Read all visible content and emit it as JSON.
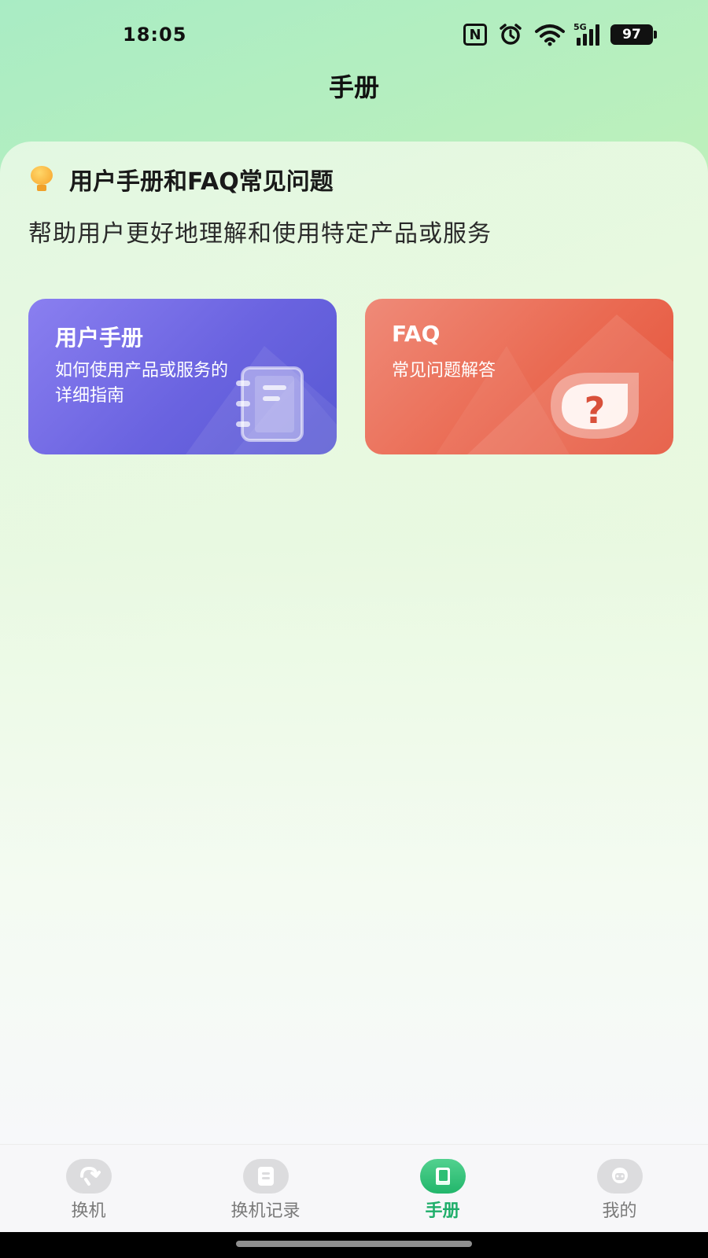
{
  "status_bar": {
    "time": "18:05",
    "nfc_label": "N",
    "network": "5G",
    "battery": "97",
    "icons": [
      "nfc-icon",
      "alarm-icon",
      "wifi-icon",
      "signal-icon",
      "battery-icon"
    ]
  },
  "header": {
    "title": "手册"
  },
  "section": {
    "title": "用户手册和FAQ常见问题",
    "description": "帮助用户更好地理解和使用特定产品或服务",
    "icon": "lightbulb-icon"
  },
  "cards": [
    {
      "title": "用户手册",
      "subtitle": "如何使用产品或服务的详细指南",
      "icon": "notebook-icon",
      "color": "#6a63e0"
    },
    {
      "title": "FAQ",
      "subtitle": "常见问题解答",
      "icon": "question-bubble-icon",
      "color": "#ea6a52"
    }
  ],
  "tab_bar": {
    "tabs": [
      {
        "label": "换机",
        "icon": "phone-swap-icon",
        "active": false
      },
      {
        "label": "换机记录",
        "icon": "document-icon",
        "active": false
      },
      {
        "label": "手册",
        "icon": "book-icon",
        "active": true
      },
      {
        "label": "我的",
        "icon": "profile-icon",
        "active": false
      }
    ],
    "active_color": "#1fae6a"
  }
}
